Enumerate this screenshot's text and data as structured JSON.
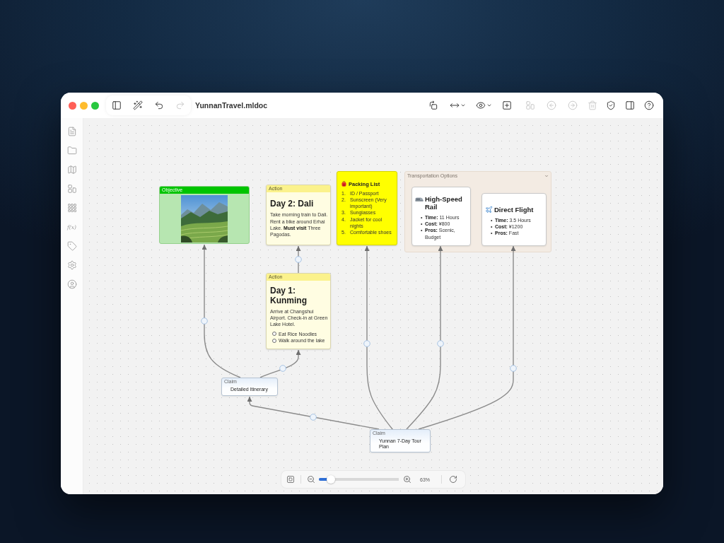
{
  "toolbar": {
    "left": [
      {
        "disabled": false
      },
      {
        "disabled": false
      },
      {
        "disabled": false
      },
      {
        "disabled": true
      }
    ],
    "document_title": "YunnanTravel.mldoc",
    "right": [
      {
        "dropdown": false,
        "disabled": false
      },
      {
        "dropdown": true,
        "disabled": false
      },
      {
        "dropdown": true,
        "disabled": false
      },
      {
        "dropdown": false,
        "disabled": false
      },
      {
        "dropdown": false,
        "disabled": true
      },
      {
        "dropdown": false,
        "disabled": true
      },
      {
        "dropdown": false,
        "disabled": true
      },
      {
        "dropdown": false,
        "disabled": true
      },
      {
        "dropdown": false,
        "disabled": false
      },
      {
        "dropdown": false,
        "disabled": false
      },
      {
        "dropdown": false,
        "disabled": false
      }
    ]
  },
  "sidebar": {
    "items": [
      {
        "kind": "icon"
      },
      {
        "kind": "icon"
      },
      {
        "kind": "icon"
      },
      {
        "kind": "icon"
      },
      {
        "kind": "icon"
      },
      {
        "kind": "text",
        "label": "f(x)"
      },
      {
        "kind": "icon"
      },
      {
        "kind": "icon"
      },
      {
        "kind": "icon"
      }
    ]
  },
  "canvas": {
    "nodes": [
      {
        "kind": "objective",
        "header": "Objective"
      },
      {
        "kind": "action",
        "header": "Action",
        "title": "Day 2: Dali",
        "text": "Take morning train to Dali. Rent a bike around Erhai Lake. **Must visit** Three Pagodas."
      },
      {
        "kind": "action",
        "header": "Action",
        "title": "Day 1: Kunming",
        "text": "Arrive at Changshui Airport. Check-in at Green Lake Hotel.",
        "tasks": [
          {
            "label": "Eat Rice Noodles",
            "checked": false
          },
          {
            "label": "Walk around the lake",
            "checked": false
          }
        ]
      },
      {
        "kind": "note",
        "title": "Packing List",
        "items": [
          {
            "number": "1.",
            "text": "ID / Passport"
          },
          {
            "number": "2.",
            "text": "Sunscreen (Very important)"
          },
          {
            "number": "3.",
            "text": "Sunglasses"
          },
          {
            "number": "4.",
            "text": "Jacket for cool nights"
          },
          {
            "number": "5.",
            "text": "Comfortable shoes"
          }
        ]
      },
      {
        "kind": "group",
        "label": "Transportation Options",
        "expanded": true,
        "cards": [
          {
            "title": "High-Speed Rail",
            "items": [
              {
                "bullet": "•",
                "text": "**Time:** 11 Hours"
              },
              {
                "bullet": "•",
                "text": "**Cost:** ¥800"
              },
              {
                "bullet": "•",
                "text": "**Pros:** Scenic, Budget"
              }
            ]
          },
          {
            "title": "Direct Flight",
            "items": [
              {
                "bullet": "•",
                "text": "**Time:** 3.5 Hours"
              },
              {
                "bullet": "•",
                "text": "**Cost:** ¥1200"
              },
              {
                "bullet": "•",
                "text": "**Pros:** Fast"
              }
            ]
          }
        ]
      },
      {
        "kind": "claim",
        "header": "Claim",
        "text": "Detailed Itinerary"
      },
      {
        "kind": "claim",
        "header": "Claim",
        "text": "Yunnan 7-Day Tour Plan"
      }
    ]
  },
  "zoom": {
    "level": 0.15,
    "reading": "63%"
  }
}
